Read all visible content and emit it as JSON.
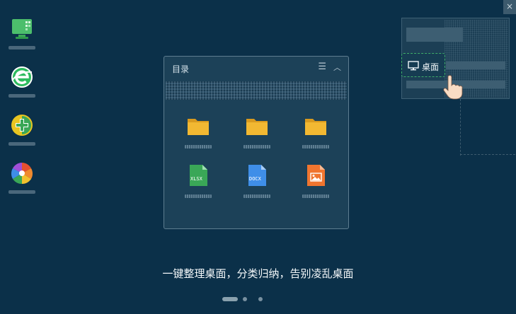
{
  "window": {
    "close_glyph": "×",
    "title": "目录",
    "menu_icon": "menu-icon",
    "collapse_icon": "chevron-up-icon"
  },
  "desktop_icons": [
    {
      "icon": "computer-app-icon",
      "color": "#4cbe6c"
    },
    {
      "icon": "browser-e-icon",
      "color": "#2dbb5e"
    },
    {
      "icon": "plus-shield-icon",
      "color": "#e8c521"
    },
    {
      "icon": "pinwheel-icon",
      "color": "#e6502f"
    }
  ],
  "files": [
    {
      "type": "folder",
      "tag": ""
    },
    {
      "type": "folder",
      "tag": ""
    },
    {
      "type": "folder",
      "tag": ""
    },
    {
      "type": "xlsx",
      "tag": "XLSX",
      "color": "#3aa757"
    },
    {
      "type": "docx",
      "tag": "DOCX",
      "color": "#3f8ee8"
    },
    {
      "type": "image",
      "tag": "",
      "color": "#f0752f"
    }
  ],
  "preview": {
    "chip_label": "桌面"
  },
  "caption": "一键整理桌面，分类归纳，告别凌乱桌面",
  "pager": {
    "count": 3,
    "active": 0
  },
  "colors": {
    "background": "#0b3049",
    "folder": "#f2b832",
    "chip_border": "#3fae6a"
  }
}
